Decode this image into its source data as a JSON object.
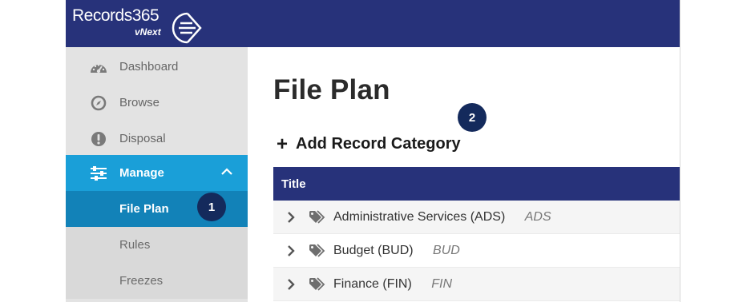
{
  "brand": {
    "name": "Records365",
    "subtitle": "vNext",
    "logo": "records365-logo-icon"
  },
  "colors": {
    "header": "#27327a",
    "manage_active": "#1a9fd8",
    "fileplan_active": "#1282b8",
    "callout": "#142a5c"
  },
  "sidebar": {
    "items": [
      {
        "label": "Dashboard",
        "icon": "dashboard-icon"
      },
      {
        "label": "Browse",
        "icon": "compass-icon"
      },
      {
        "label": "Disposal",
        "icon": "exclamation-icon"
      },
      {
        "label": "Manage",
        "icon": "sliders-icon",
        "expanded": true
      },
      {
        "label": "File Plan",
        "active": true
      },
      {
        "label": "Rules"
      },
      {
        "label": "Freezes"
      }
    ]
  },
  "main": {
    "title": "File Plan",
    "add_label": "Add Record Category",
    "table": {
      "header": "Title",
      "rows": [
        {
          "title": "Administrative Services (ADS)",
          "code": "ADS"
        },
        {
          "title": "Budget (BUD)",
          "code": "BUD"
        },
        {
          "title": "Finance (FIN)",
          "code": "FIN"
        }
      ]
    }
  },
  "callouts": [
    "1",
    "2"
  ]
}
